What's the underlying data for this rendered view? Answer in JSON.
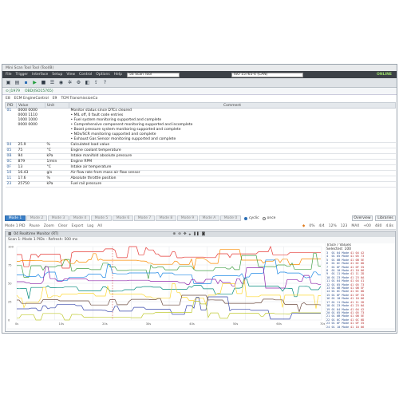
{
  "window": {
    "title": "Mini Scan Tool Tool (Tool/B)"
  },
  "menubar": {
    "items": [
      "File",
      "Trigger",
      "Interface",
      "Setup",
      "View",
      "Control",
      "Options",
      "Help"
    ],
    "scan_tool_label": "5S Scan Tool",
    "port_value": "ISO 15765-4 (CAN)",
    "status": "ONLINE"
  },
  "tabs": {
    "main": "J1979",
    "secondary": "OBD(ISO15765)"
  },
  "subhead": {
    "ecu_id": "E8",
    "ecu_name": "ECM EngineControl",
    "mode_id": "E9",
    "mode_name": "TCM TransmissionCo"
  },
  "table": {
    "headers": [
      "PID",
      "Value",
      "Unit",
      "Comment"
    ],
    "rows": [
      {
        "pid": "01",
        "value": "0000 0000\n0000 1110\n1000 1000\n0000 0000",
        "unit": "",
        "comment": "Monitor status since DTCs cleared\n• MIL off, 0 fault code entries\n• Fuel system monitoring supported and complete\n• Comprehensive component monitoring supported and incomplete\n• Boost pressure system monitoring supported and complete\n• NOx/SCR monitoring supported and complete\n• Exhaust Gas Sensor monitoring supported and complete"
      },
      {
        "pid": "04",
        "value": "25.9",
        "unit": "%",
        "comment": "Calculated load value"
      },
      {
        "pid": "05",
        "value": "75",
        "unit": "°C",
        "comment": "Engine coolant temperature"
      },
      {
        "pid": "0B",
        "value": "94",
        "unit": "kPa",
        "comment": "Intake manifold absolute pressure"
      },
      {
        "pid": "0C",
        "value": "879",
        "unit": "1/min",
        "comment": "Engine RPM"
      },
      {
        "pid": "0F",
        "value": "13",
        "unit": "°C",
        "comment": "Intake air temperature"
      },
      {
        "pid": "10",
        "value": "16.43",
        "unit": "g/s",
        "comment": "Air flow rate from mass air flow sensor"
      },
      {
        "pid": "11",
        "value": "17.6",
        "unit": "%",
        "comment": "Absolute throttle position"
      },
      {
        "pid": "23",
        "value": "25750",
        "unit": "kPa",
        "comment": "Fuel rail pressure"
      }
    ]
  },
  "selectors": {
    "buttons": [
      "Mode 1",
      "Mode 2",
      "Mode 3",
      "Mode 4",
      "Mode 5",
      "Mode 6",
      "Mode 7",
      "Mode 8",
      "Mode 9",
      "Mode A",
      "Mode 0"
    ],
    "radio_cyclic": "cyclic",
    "radio_once": "once",
    "right_buttons": [
      "Overview",
      "Libraries"
    ]
  },
  "legend": {
    "items": [
      "Mode 1 PID",
      "Pause",
      "Zoom",
      "Clear",
      "Export",
      "Log",
      "All"
    ],
    "values": [
      "0%",
      "4/4",
      "12%",
      "123",
      "MAX",
      "+00",
      "480",
      "4.8s"
    ]
  },
  "plot": {
    "title": "04 Realtime Monitor (RT)",
    "subtitle": "Scan 1: Mode 1 PIDs - Refresh: 500 ms",
    "y_ticks_left": [
      "100",
      "75",
      "50",
      "25",
      "0"
    ],
    "x_ticks": [
      "0s",
      "10s",
      "20s",
      "30s",
      "40s",
      "50s",
      "60s",
      "70s"
    ],
    "right_header": "Trace / Values",
    "right_sub": "Selected: 100",
    "trace": [
      {
        "t": "3  01 04 Mode",
        "d": "41 04 42"
      },
      {
        "t": "4  01 05 Mode",
        "d": "41 05 73"
      },
      {
        "t": "5  01 0B Mode",
        "d": "41 0B 5E"
      },
      {
        "t": "6  01 0C Mode",
        "d": "41 0C 0D"
      },
      {
        "t": "7  01 0F Mode",
        "d": "41 0F 35"
      },
      {
        "t": "8  01 10 Mode",
        "d": "41 10 06"
      },
      {
        "t": "9  01 11 Mode",
        "d": "41 11 2D"
      },
      {
        "t": "10 01 23 Mode",
        "d": "41 23 0A"
      },
      {
        "t": "11 01 04 Mode",
        "d": "41 04 41"
      },
      {
        "t": "12 01 05 Mode",
        "d": "41 05 73"
      },
      {
        "t": "13 01 0B Mode",
        "d": "41 0B 5F"
      },
      {
        "t": "14 01 0C Mode",
        "d": "41 0C 0D"
      },
      {
        "t": "15 01 0F Mode",
        "d": "41 0F 35"
      },
      {
        "t": "16 01 10 Mode",
        "d": "41 10 06"
      },
      {
        "t": "17 01 11 Mode",
        "d": "41 11 2D"
      },
      {
        "t": "18 01 23 Mode",
        "d": "41 23 0A"
      },
      {
        "t": "19 01 04 Mode",
        "d": "41 04 42"
      },
      {
        "t": "20 01 05 Mode",
        "d": "41 05 73"
      },
      {
        "t": "21 01 0B Mode",
        "d": "41 0B 5E"
      },
      {
        "t": "22 01 0C Mode",
        "d": "41 0C 0D"
      },
      {
        "t": "23 01 0F Mode",
        "d": "41 0F 35"
      },
      {
        "t": "24 01 10 Mode",
        "d": "41 10 06"
      }
    ],
    "series_colors": [
      "#e53935",
      "#fb8c00",
      "#43a047",
      "#1e88e5",
      "#8e24aa",
      "#00897b",
      "#fdd835",
      "#6d4c41",
      "#3949ab",
      "#c0ca33"
    ]
  }
}
